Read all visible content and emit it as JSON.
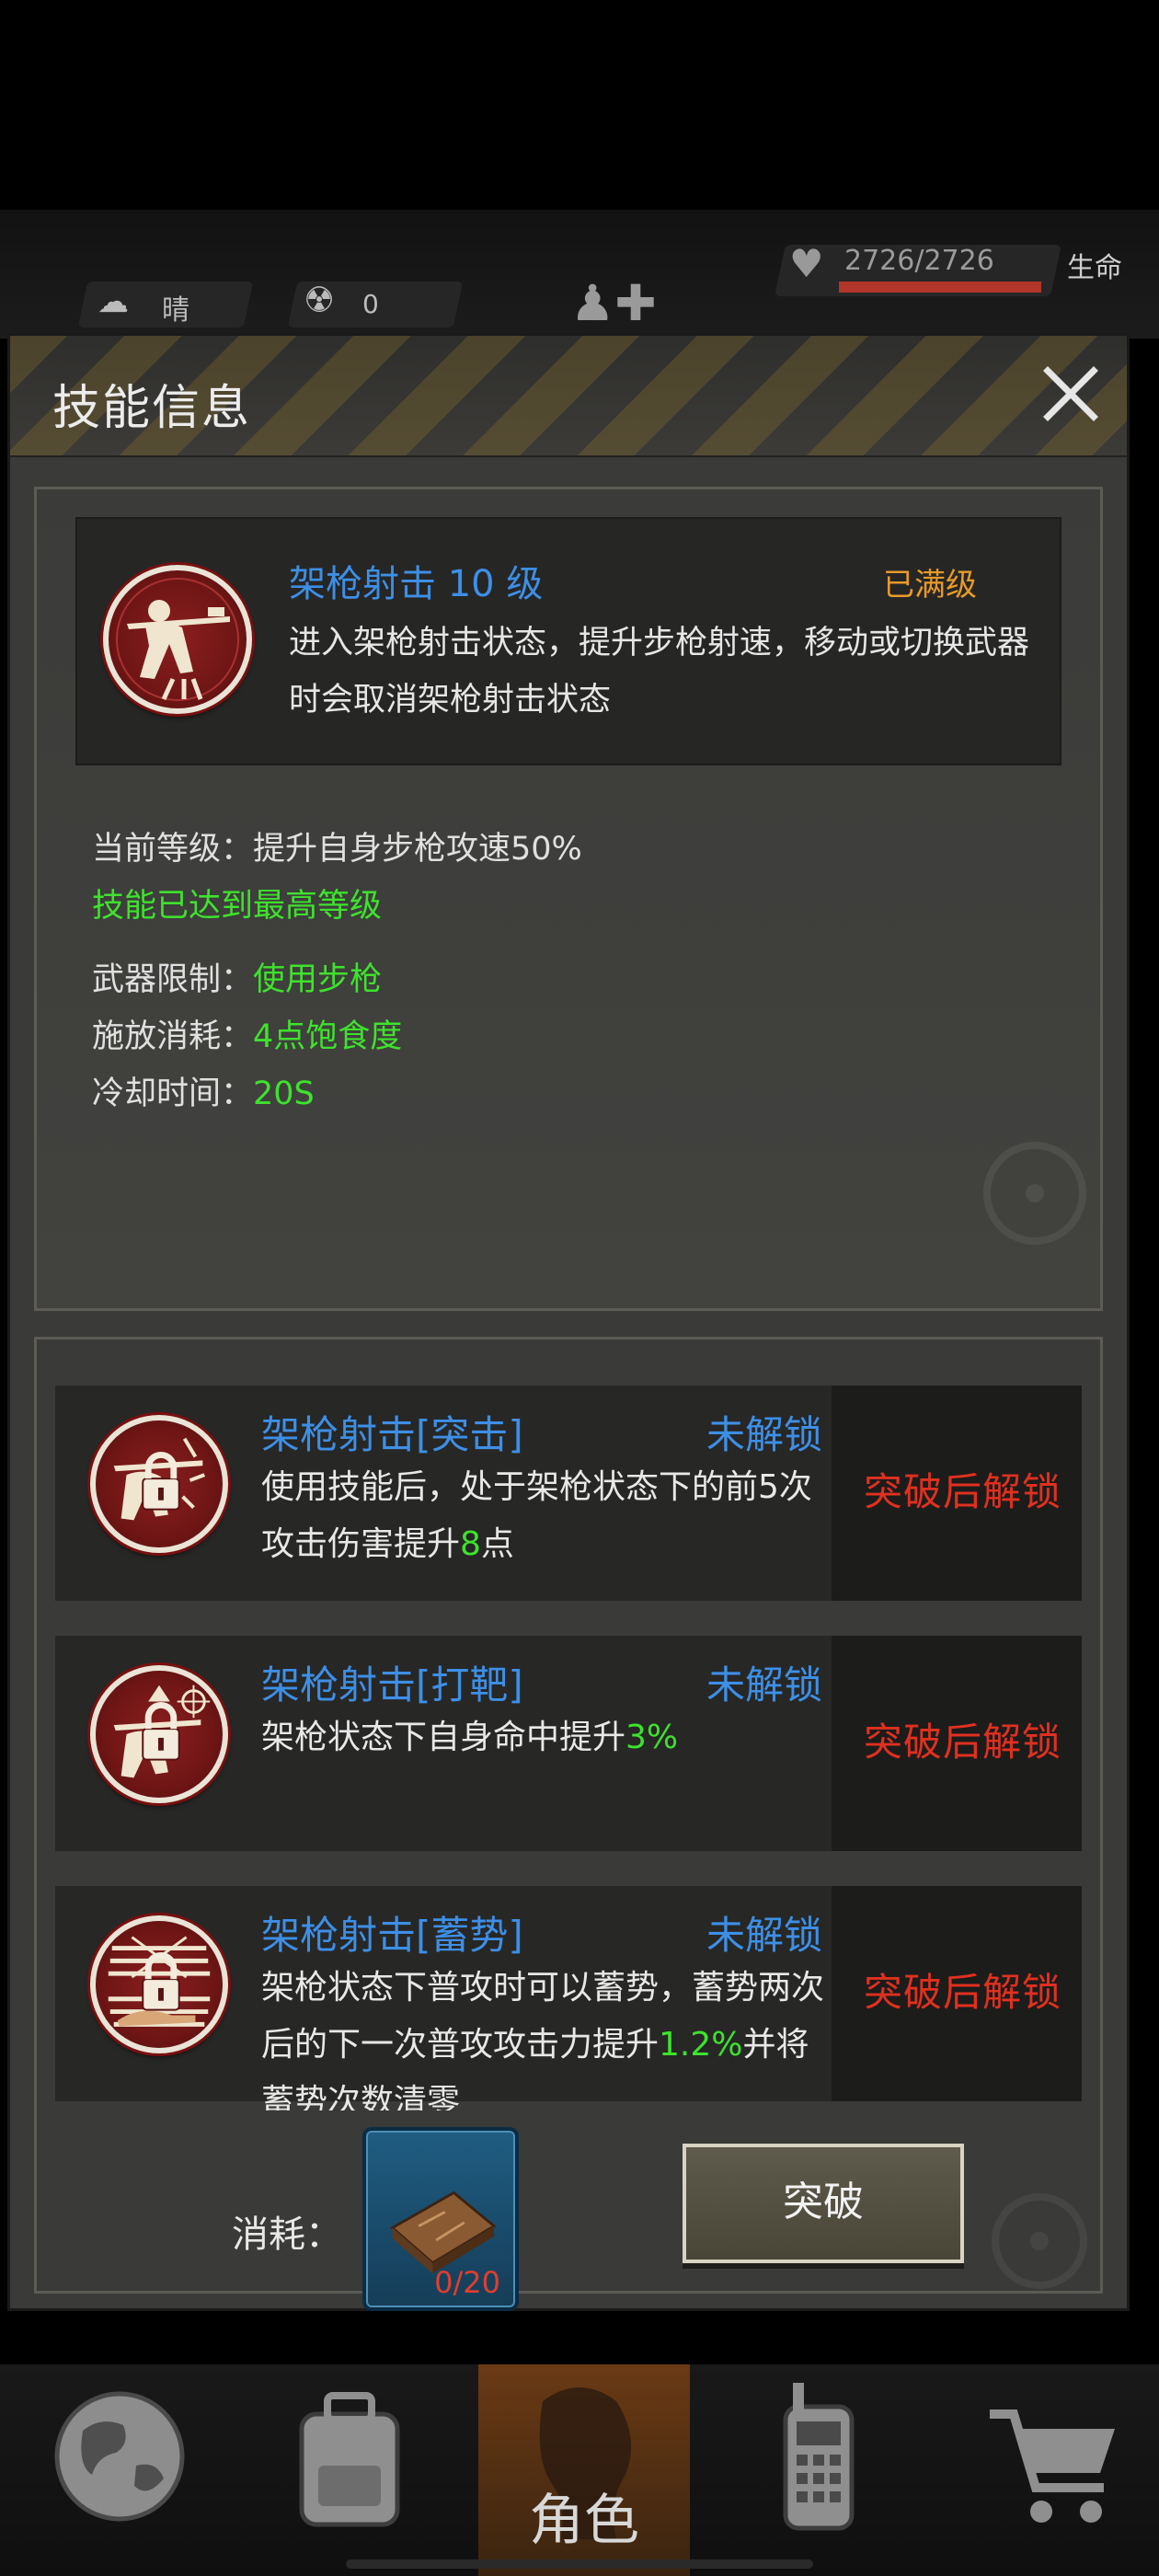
{
  "hud": {
    "weather": "晴",
    "radiation": "0",
    "hp_value": "2726/2726",
    "hp_fraction": 1.0,
    "hp_label": "生命",
    "hp_bar_color": "#b2352a"
  },
  "dialog": {
    "title": "技能信息"
  },
  "skill": {
    "name": "架枪射击 10 级",
    "max_status": "已满级",
    "description": "进入架枪射击状态，提升步枪射速，移动或切换武器时会取消架枪射击状态",
    "current_label": "当前等级：",
    "current_value": "提升自身步枪攻速50%",
    "max_notice": "技能已达到最高等级",
    "weapon_label": "武器限制：",
    "weapon_value": "使用步枪",
    "cost_label": "施放消耗：",
    "cost_value": "4点饱食度",
    "cooldown_label": "冷却时间：",
    "cooldown_value": "20S"
  },
  "breakthroughs": [
    {
      "name": "架枪射击[突击]",
      "status": "未解锁",
      "desc_a": "使用技能后，处于架枪状态下的前5次攻击伤害提升",
      "desc_hl": "8",
      "desc_b": "点",
      "lock_text": "突破后解锁"
    },
    {
      "name": "架枪射击[打靶]",
      "status": "未解锁",
      "desc_a": "架枪状态下自身命中提升",
      "desc_hl": "3%",
      "desc_b": "",
      "lock_text": "突破后解锁"
    },
    {
      "name": "架枪射击[蓄势]",
      "status": "未解锁",
      "desc_a": "架枪状态下普攻时可以蓄势，蓄势两次后的下一次普攻攻击力提升",
      "desc_hl": "1.2%",
      "desc_b": "并将蓄势次数清零",
      "lock_text": "突破后解锁"
    }
  ],
  "breakthrough_cost": {
    "label": "消耗：",
    "count": "0/20",
    "button": "突破"
  },
  "nav": {
    "active_label": "角色",
    "items": [
      "globe-icon",
      "backpack-icon",
      "character-icon",
      "radio-icon",
      "cart-icon"
    ]
  },
  "colors": {
    "accent_blue": "#3d8fe6",
    "highlight_green": "#3ee22d",
    "lock_red": "#e0301f",
    "max_orange": "#e89a29"
  }
}
